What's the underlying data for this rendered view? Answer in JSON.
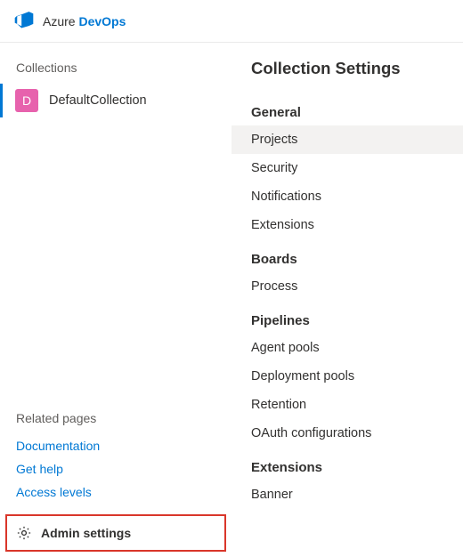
{
  "header": {
    "brand_prefix": "Azure ",
    "brand_suffix": "DevOps"
  },
  "sidebar": {
    "heading": "Collections",
    "collection": {
      "initial": "D",
      "name": "DefaultCollection"
    },
    "related_heading": "Related pages",
    "related_links": {
      "documentation": "Documentation",
      "get_help": "Get help",
      "access_levels": "Access levels"
    },
    "admin_settings_label": "Admin settings"
  },
  "settings": {
    "title": "Collection Settings",
    "groups": {
      "general": {
        "heading": "General",
        "items": {
          "projects": "Projects",
          "security": "Security",
          "notifications": "Notifications",
          "extensions": "Extensions"
        }
      },
      "boards": {
        "heading": "Boards",
        "items": {
          "process": "Process"
        }
      },
      "pipelines": {
        "heading": "Pipelines",
        "items": {
          "agent_pools": "Agent pools",
          "deployment_pools": "Deployment pools",
          "retention": "Retention",
          "oauth": "OAuth configurations"
        }
      },
      "extensions": {
        "heading": "Extensions",
        "items": {
          "banner": "Banner"
        }
      }
    }
  }
}
